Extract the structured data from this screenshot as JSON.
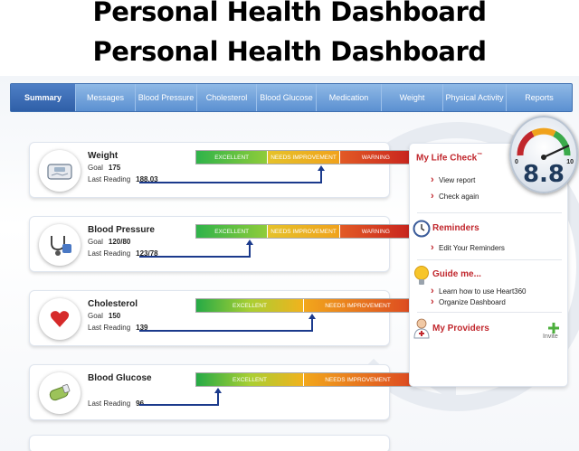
{
  "title": {
    "line1": "Personal Health Dashboard",
    "line2": "Personal Health Dashboard"
  },
  "nav": {
    "tabs": [
      {
        "label": "Summary",
        "active": true
      },
      {
        "label": "Messages"
      },
      {
        "label": "Blood Pressure"
      },
      {
        "label": "Cholesterol"
      },
      {
        "label": "Blood Glucose"
      },
      {
        "label": "Medication"
      },
      {
        "label": "Weight"
      },
      {
        "label": "Physical Activity"
      },
      {
        "label": "Reports"
      }
    ]
  },
  "cards": {
    "weight": {
      "name": "Weight",
      "goal_label": "Goal",
      "goal_value": "175",
      "reading_label": "Last Reading",
      "reading_value": "188.03",
      "scale": [
        "EXCELLENT",
        "NEEDS IMPROVEMENT",
        "WARNING"
      ]
    },
    "blood_pressure": {
      "name": "Blood Pressure",
      "goal_label": "Goal",
      "goal_value": "120/80",
      "reading_label": "Last Reading",
      "reading_value": "123/78",
      "scale": [
        "EXCELLENT",
        "NEEDS IMPROVEMENT",
        "WARNING"
      ]
    },
    "cholesterol": {
      "name": "Cholesterol",
      "goal_label": "Goal",
      "goal_value": "150",
      "reading_label": "Last Reading",
      "reading_value": "139",
      "scale": [
        "EXCELLENT",
        "NEEDS IMPROVEMENT"
      ]
    },
    "blood_glucose": {
      "name": "Blood Glucose",
      "reading_label": "Last Reading",
      "reading_value": "96",
      "scale": [
        "EXCELLENT",
        "NEEDS IMPROVEMENT"
      ]
    }
  },
  "life_check": {
    "title": "My Life Check",
    "trademark": "™",
    "links": [
      "View report",
      "Check again"
    ],
    "score": "8.8",
    "scale_min": "0",
    "scale_max": "10"
  },
  "reminders": {
    "title": "Reminders",
    "links": [
      "Edit Your Reminders"
    ]
  },
  "guide": {
    "title": "Guide me...",
    "links": [
      "Learn how to use Heart360",
      "Organize Dashboard"
    ]
  },
  "providers": {
    "title": "My Providers",
    "invite_label": "Invite"
  },
  "colors": {
    "nav_bg": "#5b90d1",
    "nav_active": "#2f5fa8",
    "accent_red": "#c1272d",
    "pointer_blue": "#1b3a8c",
    "excellent": "#2fb34a",
    "needs_improvement": "#f0a21c",
    "warning": "#c8241e"
  }
}
